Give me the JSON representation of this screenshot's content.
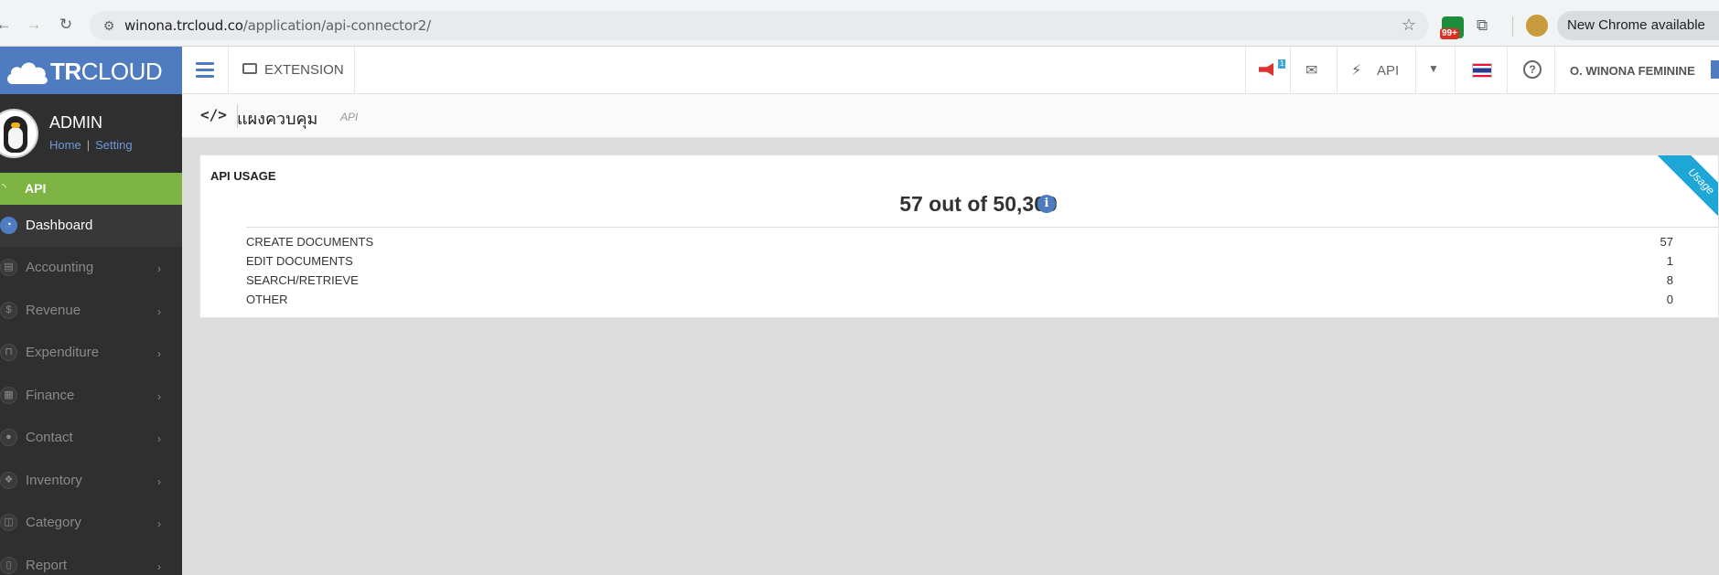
{
  "browser": {
    "url_host": "winona.trcloud.co",
    "url_path": "/application/api-connector2/",
    "extension_badge": "99+",
    "update_label": "New Chrome available"
  },
  "brand": {
    "bold": "TR",
    "light": "CLOUD"
  },
  "user": {
    "name": "ADMIN",
    "home_link": "Home",
    "setting_link": "Setting"
  },
  "sidebar": {
    "section": "API",
    "items": [
      {
        "label": "Dashboard",
        "icon": "dashboard-icon",
        "active": true
      },
      {
        "label": "Accounting",
        "icon": "book-icon"
      },
      {
        "label": "Revenue",
        "icon": "dollar-icon"
      },
      {
        "label": "Expenditure",
        "icon": "cart-icon"
      },
      {
        "label": "Finance",
        "icon": "calendar-icon"
      },
      {
        "label": "Contact",
        "icon": "person-icon"
      },
      {
        "label": "Inventory",
        "icon": "cubes-icon"
      },
      {
        "label": "Category",
        "icon": "columns-icon"
      },
      {
        "label": "Report",
        "icon": "file-icon"
      }
    ]
  },
  "topbar": {
    "extension_label": "EXTENSION",
    "notification_count": "1",
    "api_label": "API",
    "company": "O. WINONA FEMININE"
  },
  "breadcrumb": {
    "title": "แผงควบคุม",
    "subtitle": "API"
  },
  "usage": {
    "title": "API USAGE",
    "total": "57 out of 50,300",
    "ribbon": "Usage",
    "rows": [
      {
        "label": "CREATE DOCUMENTS",
        "value": "57"
      },
      {
        "label": "EDIT DOCUMENTS",
        "value": "1"
      },
      {
        "label": "SEARCH/RETRIEVE",
        "value": "8"
      },
      {
        "label": "OTHER",
        "value": "0"
      }
    ]
  },
  "colors": {
    "brand": "#4f7bc1",
    "api_section": "#7cb342",
    "ribbon": "#1ea7d6",
    "sidebar": "#2f2f2f"
  }
}
